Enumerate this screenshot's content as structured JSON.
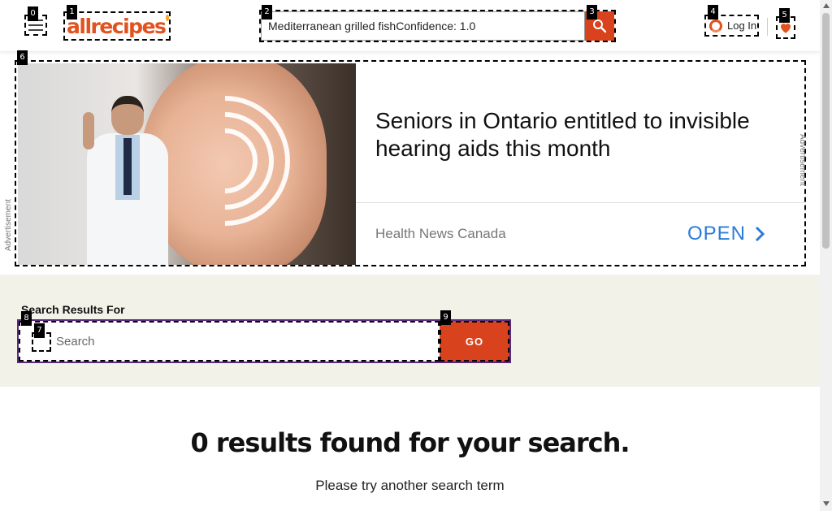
{
  "header": {
    "logo": "allrecipes",
    "search_value": "Mediterranean grilled fishConfidence: 1.0",
    "login_label": "Log In"
  },
  "ad": {
    "label": "Advertisement",
    "headline": "Seniors in Ontario entitled to invisible hearing aids this month",
    "source": "Health News Canada",
    "cta": "OPEN"
  },
  "search_section": {
    "label": "Search Results For",
    "placeholder": "Search",
    "go_label": "GO"
  },
  "results": {
    "title": "0 results found for your search.",
    "subtitle": "Please try another search term"
  },
  "badges": [
    "0",
    "1",
    "2",
    "3",
    "4",
    "5",
    "6",
    "7",
    "8",
    "9"
  ],
  "colors": {
    "brand": "#e2521e",
    "search_button": "#d8431d",
    "cta": "#2a7bd8",
    "band": "#f2f2e9",
    "form_border": "#5b2a7e"
  }
}
